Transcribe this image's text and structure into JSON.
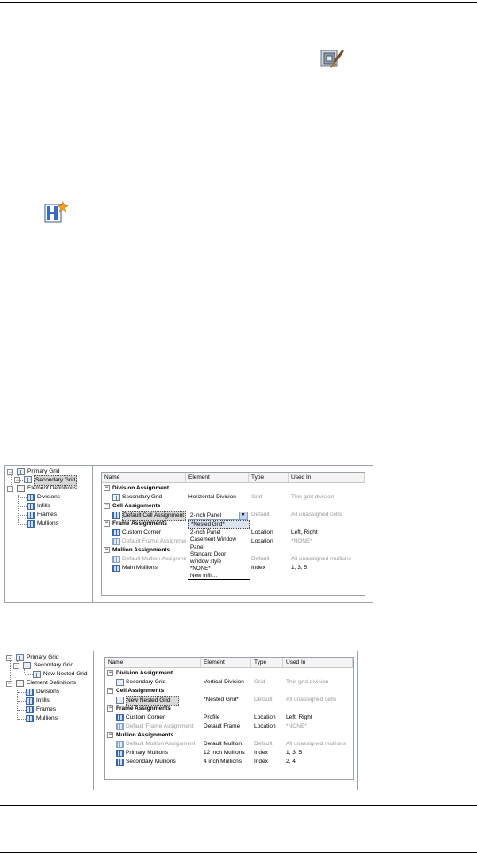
{
  "icons": {
    "top_tool": "edit-style-brush-icon",
    "mid_tool": "new-style-star-icon"
  },
  "panel1": {
    "tree": [
      {
        "label": "Primary Grid"
      },
      {
        "label": "Secondary Grid"
      },
      {
        "label": "Element Definitions"
      },
      {
        "label": "Divisions"
      },
      {
        "label": "Infills"
      },
      {
        "label": "Frames"
      },
      {
        "label": "Mullions"
      }
    ],
    "headers": [
      "Name",
      "Element",
      "Type",
      "Used In"
    ],
    "groups": {
      "division": "Division Assignment",
      "cell": "Cell Assignments",
      "frame": "Frame Assignments",
      "mullion": "Mullion Assignments"
    },
    "rows": {
      "secondary_grid": [
        "Secondary Grid",
        "Horizontal Division",
        "Grid",
        "This grid division"
      ],
      "default_cell": [
        "Default Cell Assignment",
        "2-inch Panel",
        "Default",
        "All unassigned cells"
      ],
      "custom_corner": [
        "Custom Corner",
        "",
        "Location",
        "Left, Right"
      ],
      "default_frame": [
        "Default Frame Assignment",
        "",
        "Location",
        "*NONE*"
      ],
      "default_mullion": [
        "Default Mullion Assignment",
        "",
        "Default",
        "All unassigned mullions"
      ],
      "main_mullions": [
        "Main Mullions",
        "",
        "Index",
        "1, 3, 5"
      ]
    },
    "dropdown_options": [
      "*Nested Grid*",
      "2-inch Panel",
      "Casement Window",
      "Panel",
      "Standard Door",
      "window style",
      "*NONE*",
      "New Infill..."
    ]
  },
  "panel2": {
    "tree": [
      {
        "label": "Primary Grid"
      },
      {
        "label": "Secondary Grid"
      },
      {
        "label": "New Nested Grid"
      },
      {
        "label": "Element Definitions"
      },
      {
        "label": "Divisions"
      },
      {
        "label": "Infills"
      },
      {
        "label": "Frames"
      },
      {
        "label": "Mullions"
      }
    ],
    "headers": [
      "Name",
      "Element",
      "Type",
      "Used In"
    ],
    "groups": {
      "division": "Division Assignment",
      "cell": "Cell Assignments",
      "frame": "Frame Assignments",
      "mullion": "Mullion Assignments"
    },
    "rows": {
      "secondary_grid": [
        "Secondary Grid",
        "Vertical Division",
        "Grid",
        "This grid division"
      ],
      "new_nested": [
        "New Nested Grid",
        "*Nested Grid*",
        "Default",
        "All unassigned cells"
      ],
      "custom_corner": [
        "Custom Corner",
        "Profile",
        "Location",
        "Left, Right"
      ],
      "default_frame": [
        "Default Frame Assignment",
        "Default Frame",
        "Location",
        "*NONE*"
      ],
      "default_mullion": [
        "Default Mullion Assignment",
        "Default Mullion",
        "Default",
        "All unassigned mullions"
      ],
      "primary_mullions": [
        "Primary Mullions",
        "12 inch Mullions",
        "Index",
        "1, 3, 5"
      ],
      "secondary_mullions": [
        "Secondary Mullions",
        "4 inch Mullions",
        "Index",
        "2, 4"
      ]
    }
  }
}
